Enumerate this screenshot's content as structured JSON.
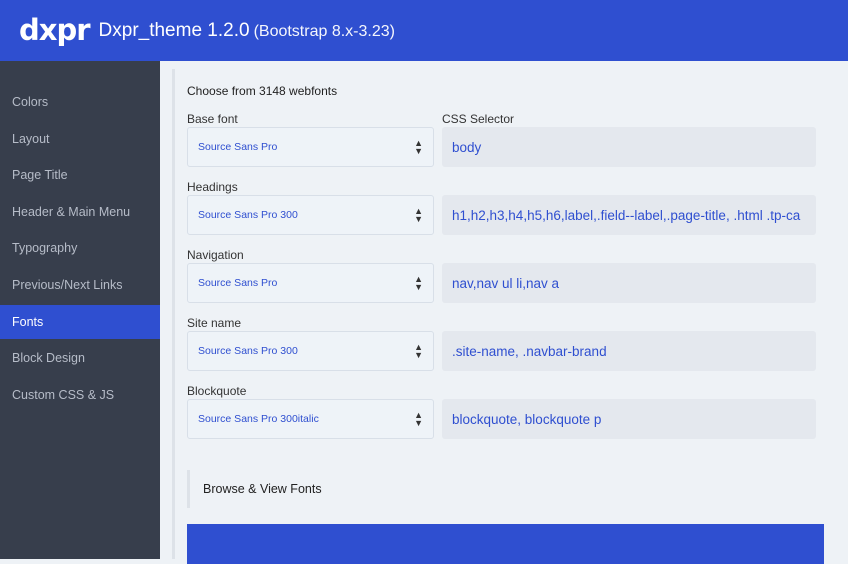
{
  "header": {
    "logo": "dxpr",
    "title": "Dxpr_theme 1.2.0",
    "version": "(Bootstrap 8.x-3.23)",
    "brand_color": "#2f4fd0"
  },
  "sidebar": {
    "items": [
      {
        "label": "Colors"
      },
      {
        "label": "Layout"
      },
      {
        "label": "Page Title"
      },
      {
        "label": "Header & Main Menu"
      },
      {
        "label": "Typography"
      },
      {
        "label": "Previous/Next Links"
      },
      {
        "label": "Fonts",
        "active": true
      },
      {
        "label": "Block Design"
      },
      {
        "label": "Custom CSS & JS"
      }
    ]
  },
  "main": {
    "intro": "Choose from 3148 webfonts",
    "selector_header": "CSS Selector",
    "rows": [
      {
        "label": "Base font",
        "font": "Source Sans Pro",
        "selector": "body"
      },
      {
        "label": "Headings",
        "font": "Source Sans Pro 300",
        "selector": "h1,h2,h3,h4,h5,h6,label,.field--label,.page-title, .html .tp-ca"
      },
      {
        "label": "Navigation",
        "font": "Source Sans Pro",
        "selector": "nav,nav ul li,nav a"
      },
      {
        "label": "Site name",
        "font": "Source Sans Pro 300",
        "selector": ".site-name, .navbar-brand"
      },
      {
        "label": "Blockquote",
        "font": "Source Sans Pro 300italic",
        "selector": "blockquote, blockquote p"
      }
    ],
    "browse": "Browse & View Fonts"
  }
}
